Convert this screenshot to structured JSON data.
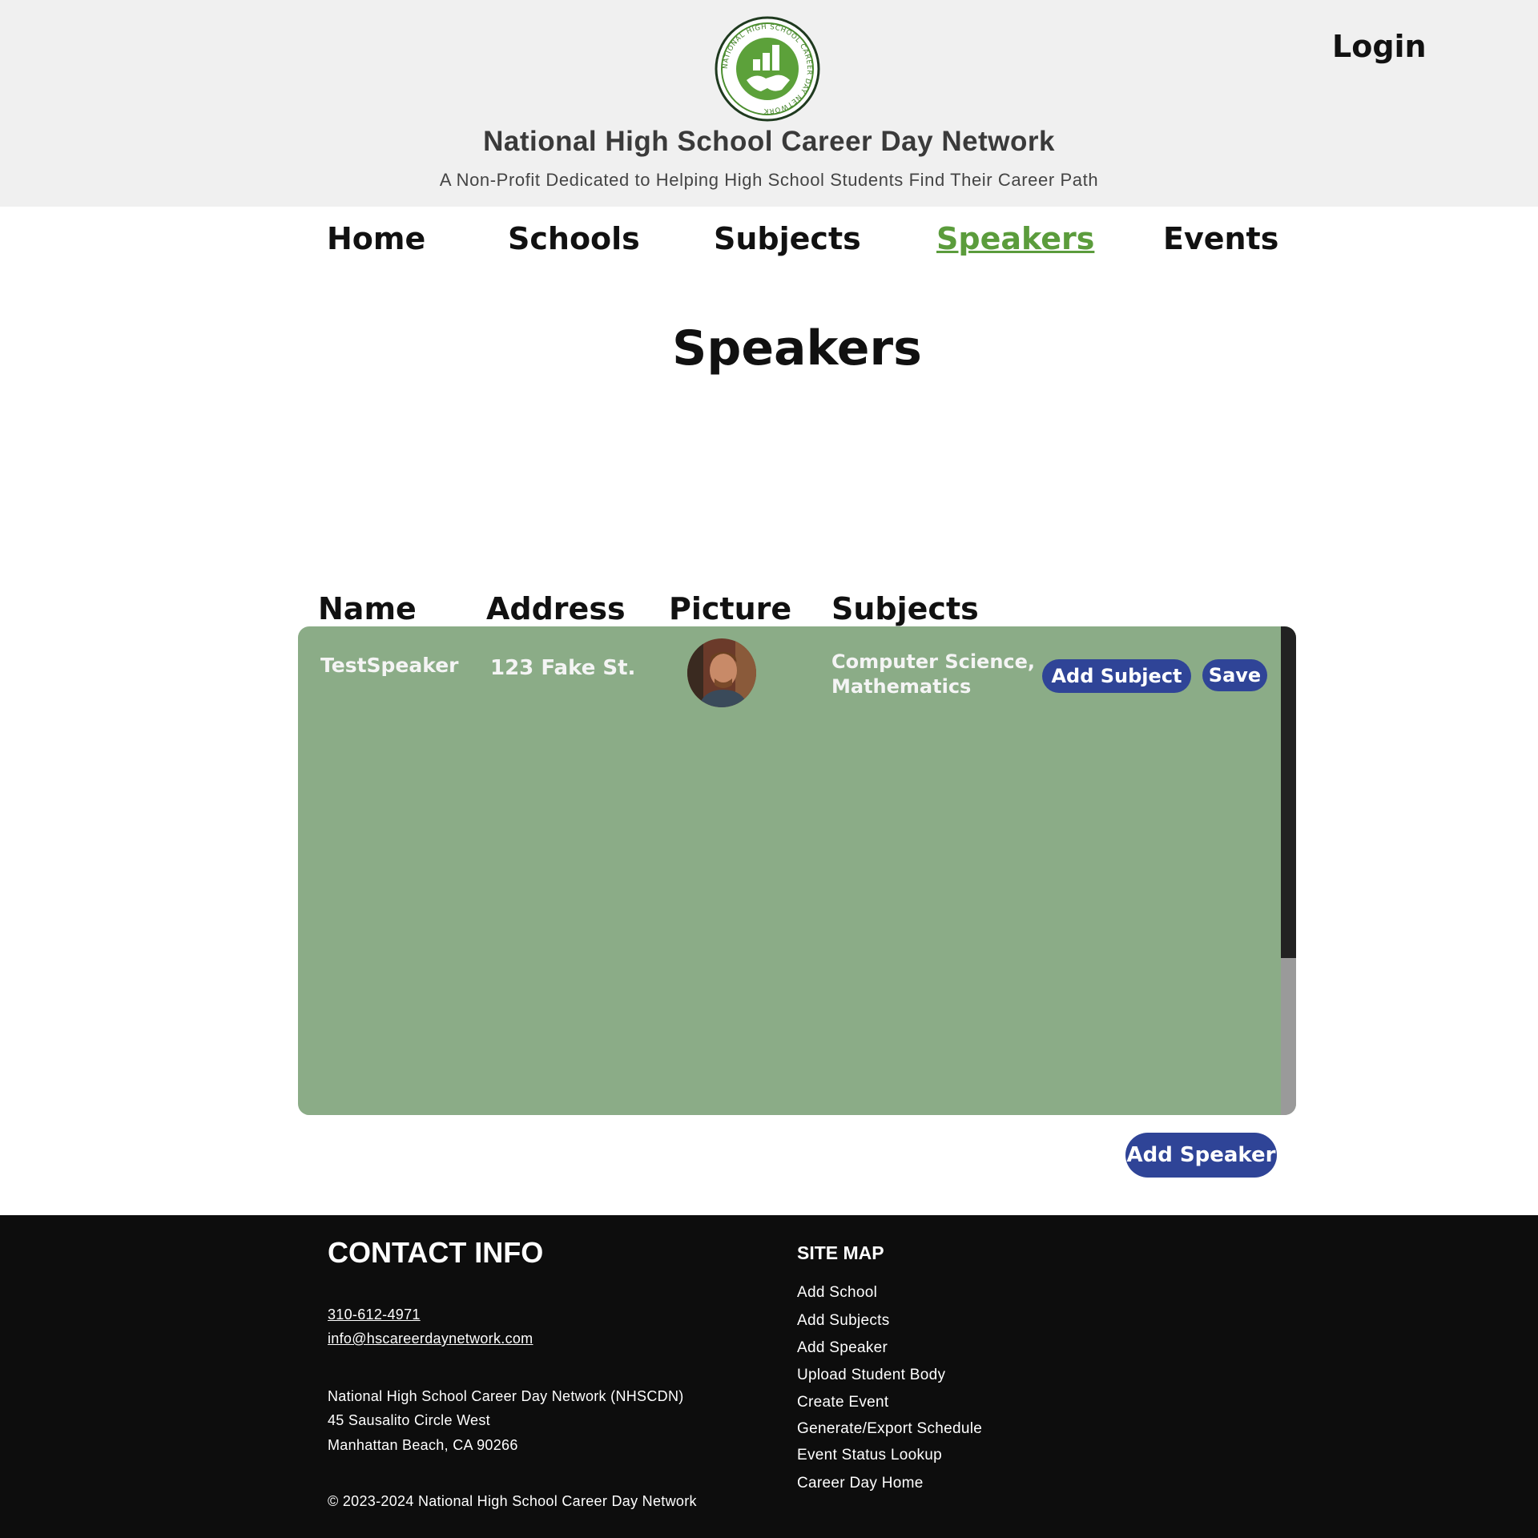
{
  "header": {
    "site_title": "National High School Career Day Network",
    "tagline": "A Non-Profit Dedicated to Helping High School Students Find Their Career Path",
    "logo_text": "NATIONAL HIGH SCHOOL CAREER DAY NETWORK",
    "login_label": "Login"
  },
  "nav": {
    "items": [
      {
        "label": "Home"
      },
      {
        "label": "Schools"
      },
      {
        "label": "Subjects"
      },
      {
        "label": "Speakers",
        "active": true
      },
      {
        "label": "Events"
      }
    ],
    "active_color": "#5b9c3c"
  },
  "page": {
    "heading": "Speakers"
  },
  "table": {
    "columns": [
      "Name",
      "Address",
      "Picture",
      "Subjects"
    ],
    "rows": [
      {
        "name": "TestSpeaker",
        "address": "123 Fake St.",
        "picture": "speaker-avatar",
        "subjects_line1": "Computer Science,",
        "subjects_line2": "Mathematics",
        "add_subject_label": "Add Subject",
        "save_label": "Save"
      }
    ],
    "background_color": "#8bac87"
  },
  "actions": {
    "add_speaker_label": "Add Speaker",
    "button_color": "#2f4497"
  },
  "footer": {
    "contact_heading": "CONTACT INFO",
    "phone": "310-612-4971",
    "email": "info@hscareerdaynetwork.com",
    "org_name": "National High School Career Day Network (NHSCDN)",
    "address_line1": "45 Sausalito Circle West",
    "address_line2": "Manhattan Beach, CA 90266",
    "copyright": "© 2023-2024 National High School Career Day Network",
    "sitemap_heading": "SITE MAP",
    "sitemap": [
      {
        "label": "Add School"
      },
      {
        "label": "Add Subjects"
      },
      {
        "label": "Add Speaker"
      },
      {
        "label": "Upload Student Body"
      },
      {
        "label": "Create Event"
      },
      {
        "label": "Generate/Export Schedule"
      },
      {
        "label": "Event Status Lookup"
      },
      {
        "label": "Career Day Home"
      }
    ]
  }
}
